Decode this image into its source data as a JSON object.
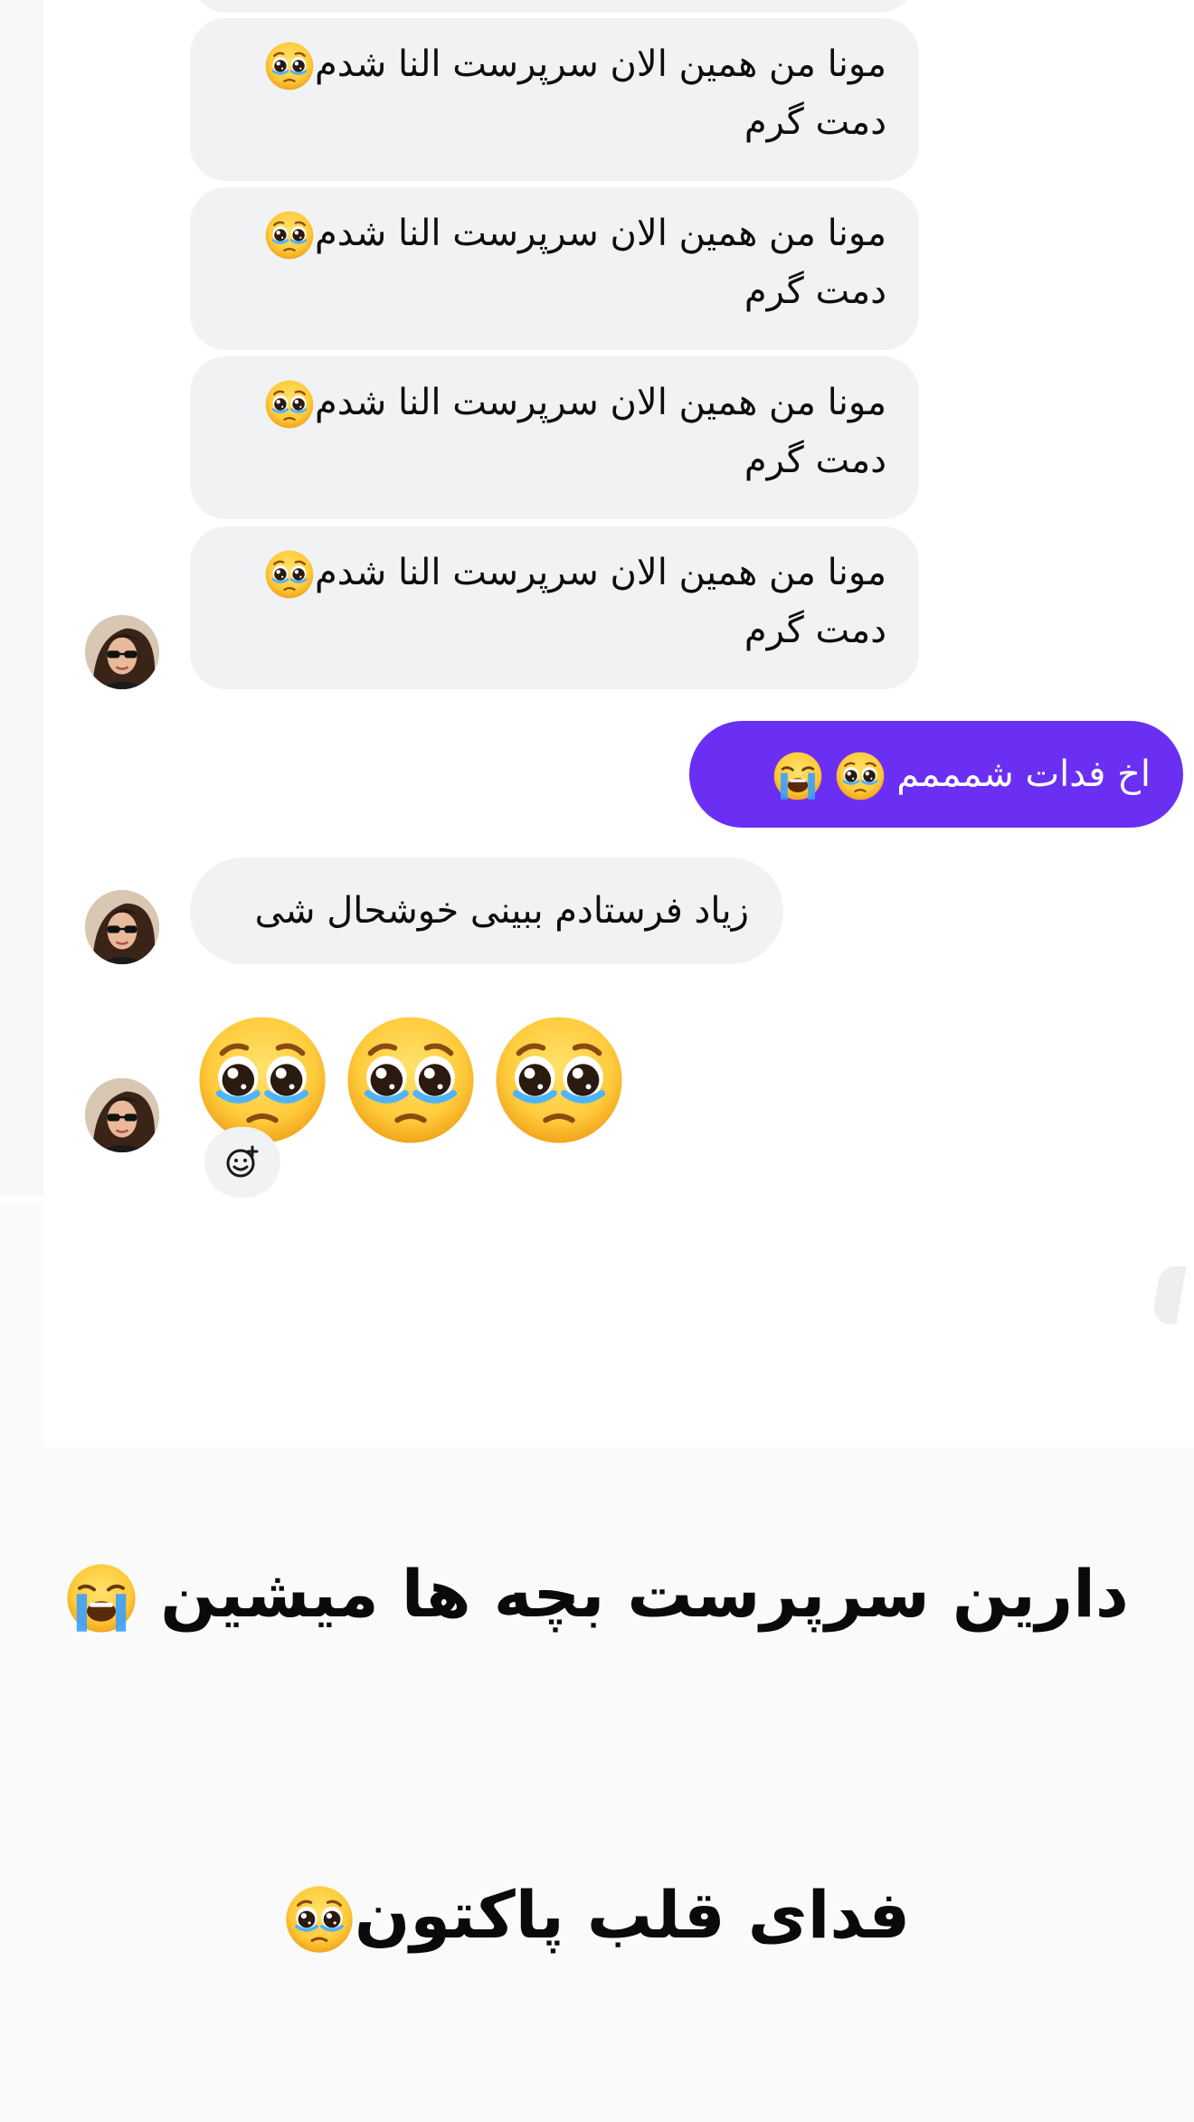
{
  "messages": {
    "incoming_repeated": [
      {
        "line1": "مونا من همین الان سرپرست النا شدم",
        "line2": "دمت گرم",
        "emoji": "pleading-face"
      },
      {
        "line1": "مونا من همین الان سرپرست النا شدم",
        "line2": "دمت گرم",
        "emoji": "pleading-face"
      },
      {
        "line1": "مونا من همین الان سرپرست النا شدم",
        "line2": "دمت گرم",
        "emoji": "pleading-face"
      },
      {
        "line1": "مونا من همین الان سرپرست النا شدم",
        "line2": "دمت گرم",
        "emoji": "pleading-face"
      }
    ],
    "outgoing": {
      "text": "اخ فدات شمممم",
      "emojis": [
        "pleading-face",
        "loudly-crying-face"
      ]
    },
    "incoming_single": {
      "text": "زیاد فرستادم ببینی خوشحال شی"
    },
    "incoming_emojis": [
      "pleading-face",
      "pleading-face",
      "pleading-face"
    ]
  },
  "captions": {
    "line1": "دارین سرپرست بچه ها میشین",
    "line1_emoji": "loudly-crying-face",
    "line2": "فدای قلب پاکتون",
    "line2_emoji": "pleading-face"
  },
  "icons": {
    "avatar": "avatar-woman-sunglasses",
    "react": "add-reaction-icon"
  },
  "colors": {
    "outgoing_bubble": "#6a2ff3",
    "incoming_bubble": "#f1f2f4",
    "caption_text": "#0a0a0a"
  }
}
